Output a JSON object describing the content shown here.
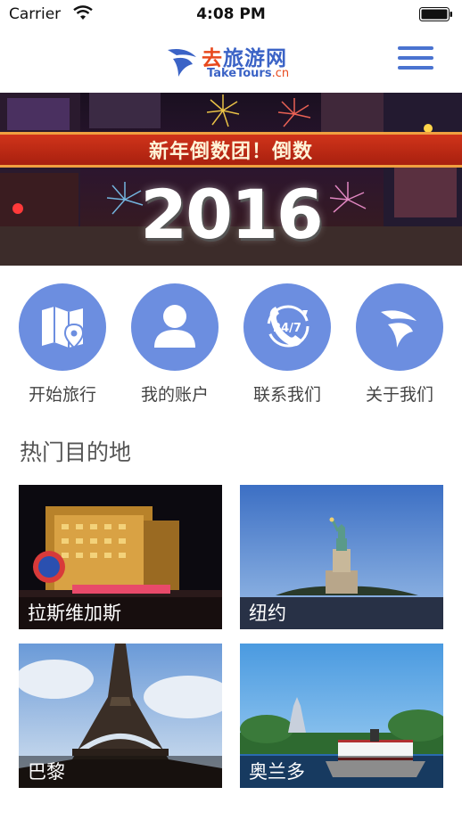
{
  "status_bar": {
    "carrier": "Carrier",
    "time": "4:08 PM"
  },
  "nav": {
    "logo_cn_1": "去",
    "logo_cn_2": "旅游网",
    "logo_en": "TakeTours",
    "logo_domain": ".cn",
    "menu_icon": "hamburger-menu-icon"
  },
  "banner": {
    "subtitle": "新年倒数团！倒数",
    "year": "2016"
  },
  "actions": [
    {
      "label": "开始旅行",
      "icon": "map-pin-icon"
    },
    {
      "label": "我的账户",
      "icon": "user-icon"
    },
    {
      "label": "联系我们",
      "icon": "phone-24-7-icon"
    },
    {
      "label": "关于我们",
      "icon": "brand-logo-icon"
    }
  ],
  "section": {
    "title": "热门目的地"
  },
  "destinations": [
    {
      "label": "拉斯维加斯"
    },
    {
      "label": "纽约"
    },
    {
      "label": "巴黎"
    },
    {
      "label": "奥兰多"
    }
  ],
  "colors": {
    "accent": "#6c8ee0",
    "brand_blue": "#3b63c6",
    "brand_orange": "#e8491d"
  }
}
